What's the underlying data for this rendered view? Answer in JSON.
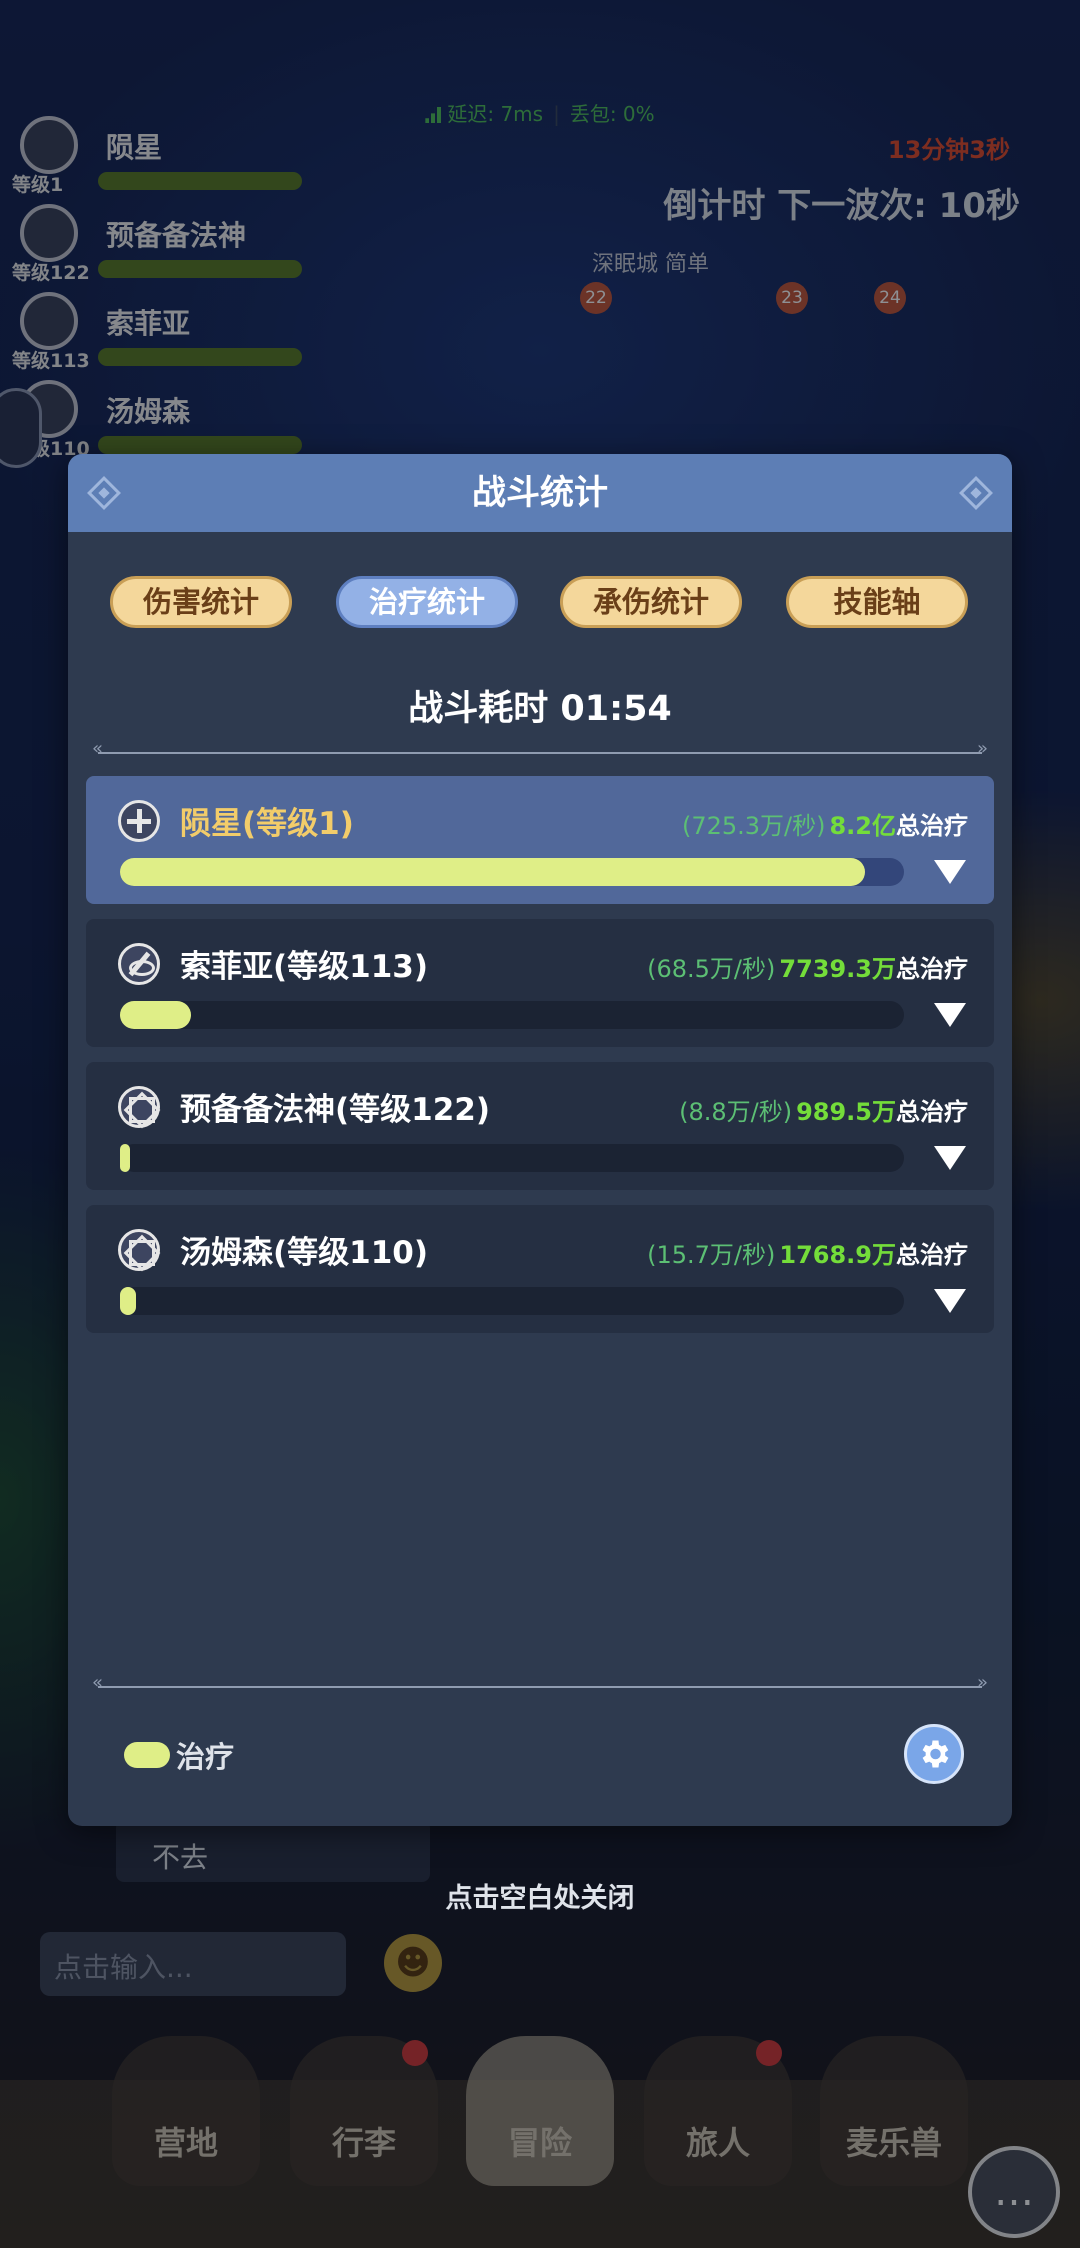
{
  "background": {
    "net_latency": "延迟: 7ms",
    "net_loss": "丢包: 0%",
    "party": [
      {
        "name": "陨星",
        "level": "等级1"
      },
      {
        "name": "预备备法神",
        "level": "等级122"
      },
      {
        "name": "索菲亚",
        "level": "等级113"
      },
      {
        "name": "汤姆森",
        "level": "等级110"
      }
    ],
    "elapsed": "13分钟3秒",
    "countdown": "倒计时 下一波次: 10秒",
    "area": "深眠城  简单",
    "waves": [
      "22",
      "23",
      "24"
    ],
    "chat_line": "不去",
    "chat_placeholder": "点击输入...",
    "close_hint": "点击空白处关闭",
    "nav": [
      {
        "label": "营地",
        "active": false,
        "badge": false
      },
      {
        "label": "行李",
        "active": false,
        "badge": true
      },
      {
        "label": "冒险",
        "active": true,
        "badge": false
      },
      {
        "label": "旅人",
        "active": false,
        "badge": true
      },
      {
        "label": "麦乐兽",
        "active": false,
        "badge": false
      }
    ]
  },
  "modal": {
    "title": "战斗统计",
    "tabs": [
      {
        "label": "伤害统计",
        "active": false
      },
      {
        "label": "治疗统计",
        "active": true
      },
      {
        "label": "承伤统计",
        "active": false
      },
      {
        "label": "技能轴",
        "active": false
      }
    ],
    "duration": "战斗耗时  01:54",
    "rows": [
      {
        "name": "陨星(等级1)",
        "rate": "(725.3万/秒)",
        "total": "8.2亿",
        "suffix": "总治疗",
        "icon": "cross-crest-icon",
        "fraction": 0.95,
        "active": true
      },
      {
        "name": "索菲亚(等级113)",
        "rate": "(68.5万/秒)",
        "total": "7739.3万",
        "suffix": "总治疗",
        "icon": "blade-crest-icon",
        "fraction": 0.09,
        "active": false
      },
      {
        "name": "预备备法神(等级122)",
        "rate": "(8.8万/秒)",
        "total": "989.5万",
        "suffix": "总治疗",
        "icon": "star-crest-icon",
        "fraction": 0.012,
        "active": false
      },
      {
        "name": "汤姆森(等级110)",
        "rate": "(15.7万/秒)",
        "total": "1768.9万",
        "suffix": "总治疗",
        "icon": "star-crest-icon",
        "fraction": 0.021,
        "active": false
      }
    ],
    "legend": "治疗",
    "colors": {
      "heal_bar": "#dfee87",
      "total_green": "#74dd3a",
      "header": "#5d7eb5"
    }
  }
}
